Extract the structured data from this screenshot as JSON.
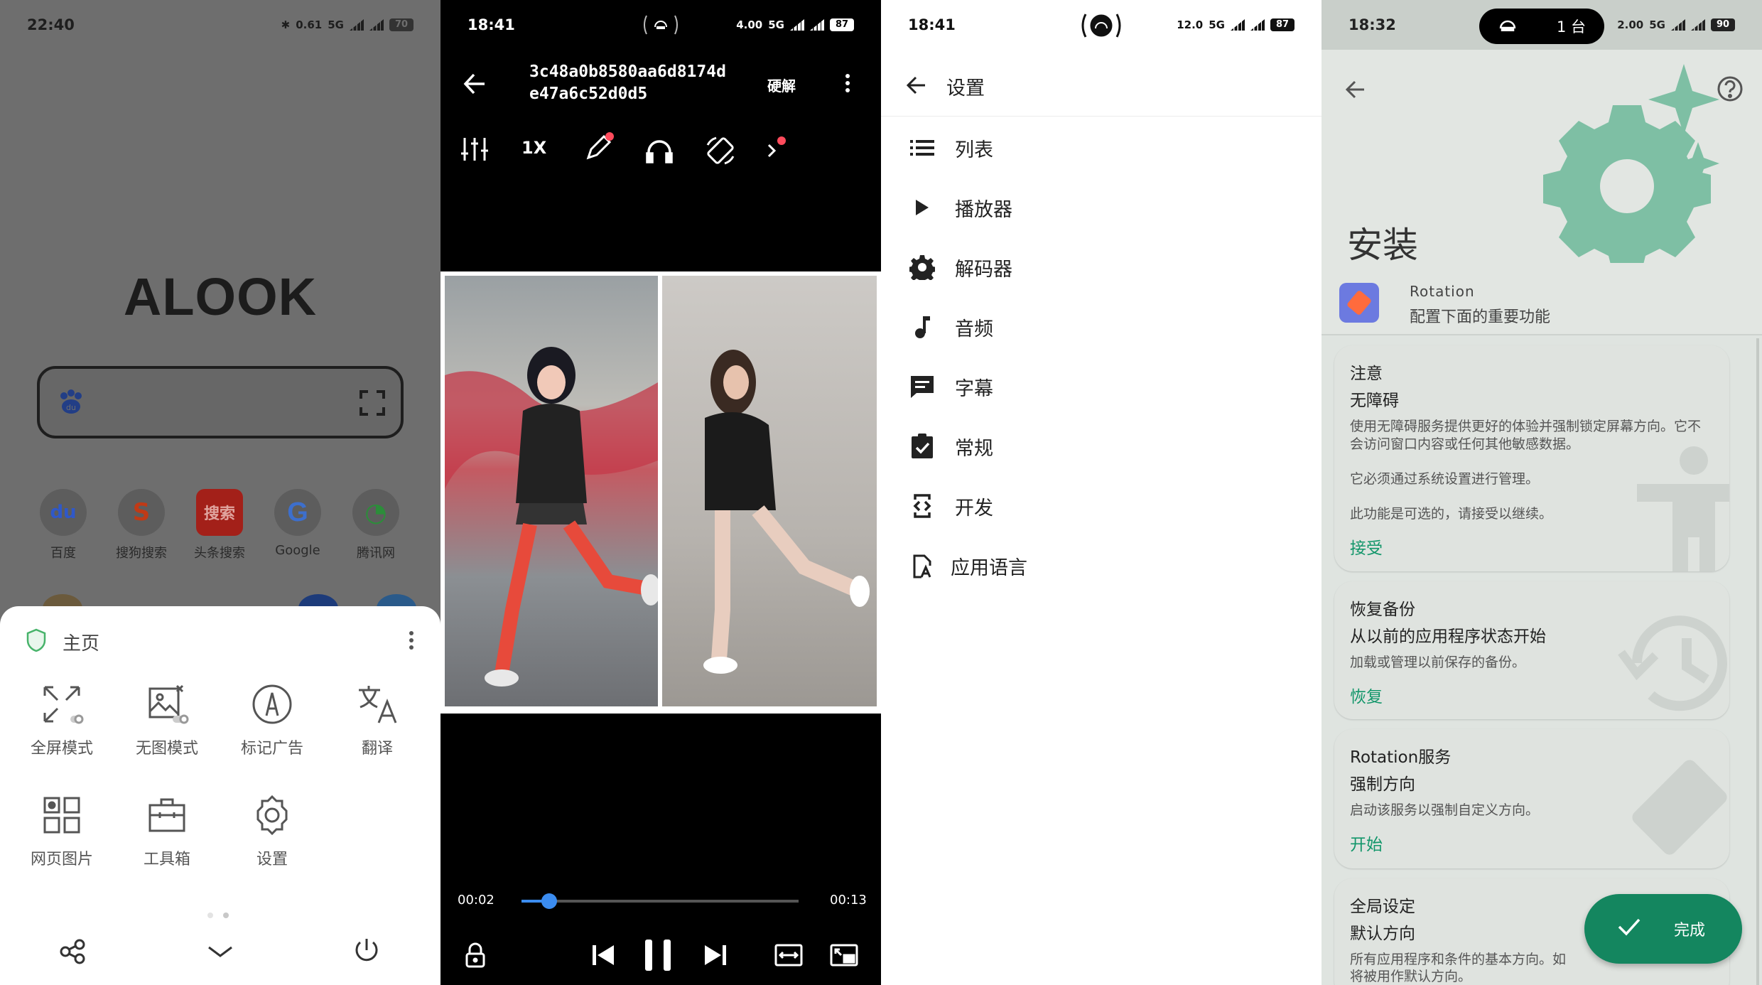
{
  "panel1": {
    "status": {
      "time": "22:40",
      "speed": "0.61",
      "speed_unit": "KB/S",
      "net": "5G",
      "battery": "70"
    },
    "logo": "ALOOK",
    "sites": [
      {
        "label": "百度",
        "glyph": "du",
        "color": "#2f58c9"
      },
      {
        "label": "搜狗搜索",
        "glyph": "S",
        "color": "#e0431d"
      },
      {
        "label": "头条搜索",
        "glyph": "搜索",
        "color": "#d3241c"
      },
      {
        "label": "Google",
        "glyph": "G",
        "color": "#3f78e0"
      },
      {
        "label": "腾讯网",
        "glyph": "◔",
        "color": "#2c9b3c"
      }
    ],
    "sheet": {
      "title": "主页",
      "tools": [
        {
          "label": "全屏模式"
        },
        {
          "label": "无图模式"
        },
        {
          "label": "标记广告"
        },
        {
          "label": "翻译"
        },
        {
          "label": "网页图片"
        },
        {
          "label": "工具箱"
        },
        {
          "label": "设置"
        }
      ]
    }
  },
  "panel2": {
    "status": {
      "time": "18:41",
      "speed": "4.00",
      "speed_unit": "KB/S",
      "net": "5G",
      "battery": "87"
    },
    "title": "3c48a0b8580aa6d8174de47a6c52d0d5",
    "hw_label": "硬解",
    "speed_label": "1X",
    "time_current": "00:02",
    "time_total": "00:13",
    "progress": 0.1
  },
  "panel3": {
    "status": {
      "time": "18:41",
      "speed": "12.0",
      "speed_unit": "KB/S",
      "net": "5G",
      "battery": "87"
    },
    "title": "设置",
    "items": [
      {
        "label": "列表",
        "icon": "list-icon"
      },
      {
        "label": "播放器",
        "icon": "play-icon"
      },
      {
        "label": "解码器",
        "icon": "gear-icon"
      },
      {
        "label": "音频",
        "icon": "music-note-icon"
      },
      {
        "label": "字幕",
        "icon": "subtitle-icon"
      },
      {
        "label": "常规",
        "icon": "clipboard-check-icon"
      },
      {
        "label": "开发",
        "icon": "developer-icon"
      },
      {
        "label": "应用语言",
        "icon": "language-icon"
      }
    ]
  },
  "panel4": {
    "status": {
      "time": "18:32",
      "speed": "2.00",
      "speed_unit": "KB/S",
      "net": "5G",
      "battery": "90",
      "pill_text": "1 台"
    },
    "title": "安装",
    "app_name": "Rotation",
    "app_subtitle": "配置下面的重要功能",
    "accent": "#14865f",
    "cards": [
      {
        "title": "注意",
        "subtitle": "无障碍",
        "desc": [
          "使用无障碍服务提供更好的体验并强制锁定屏幕方向。它不会访问窗口内容或任何其他敏感数据。",
          "它必须通过系统设置进行管理。",
          "此功能是可选的，请接受以继续。"
        ],
        "action": "接受"
      },
      {
        "title": "恢复备份",
        "subtitle": "从以前的应用程序状态开始",
        "desc": [
          "加载或管理以前保存的备份。"
        ],
        "action": "恢复"
      },
      {
        "title": "Rotation服务",
        "subtitle": "强制方向",
        "desc": [
          "启动该服务以强制自定义方向。"
        ],
        "action": "开始"
      },
      {
        "title": "全局设定",
        "subtitle": "默认方向",
        "desc": [
          "所有应用程序和条件的基本方向。如",
          "将被用作默认方向。"
        ],
        "action": ""
      }
    ],
    "fab_label": "完成"
  }
}
